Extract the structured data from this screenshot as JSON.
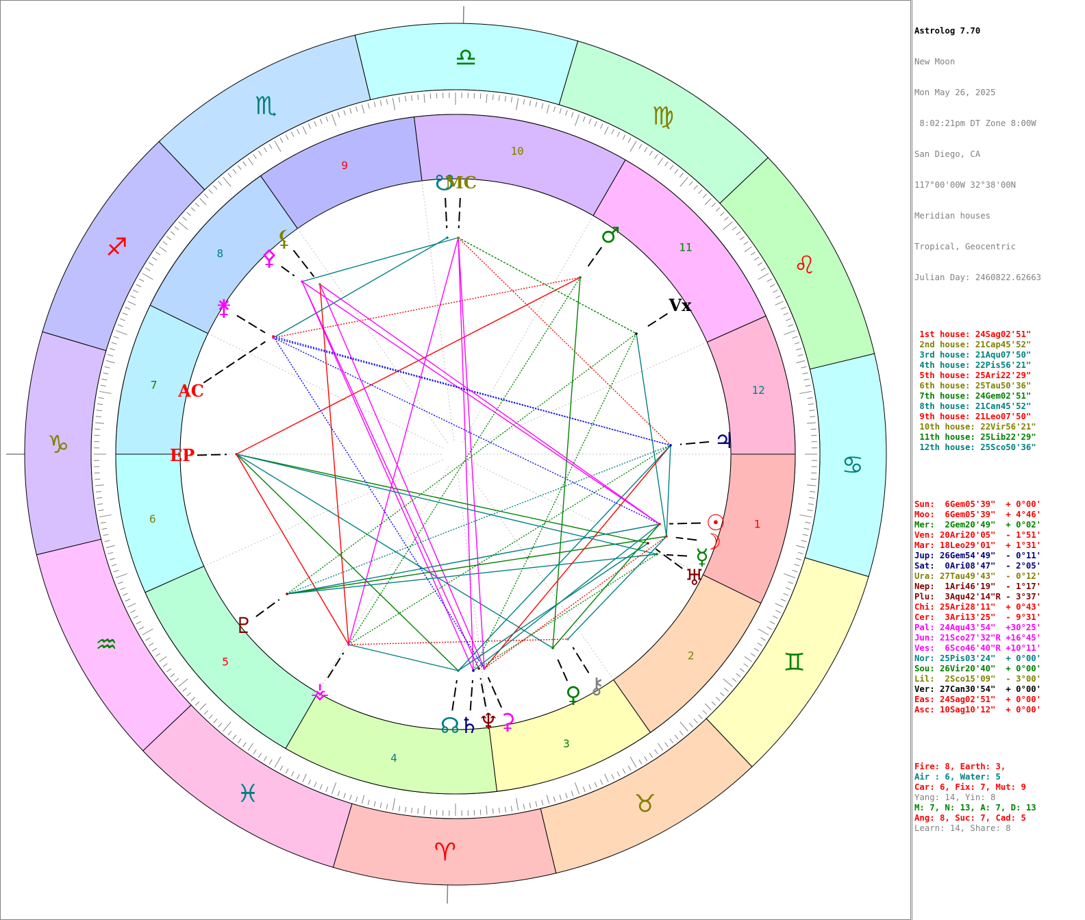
{
  "app": {
    "title": "Astrolog 7.70",
    "chart_name": "New Moon",
    "date": "Mon May 26, 2025",
    "time": " 8:02:21pm DT Zone 8:00W",
    "place": "San Diego, CA",
    "coords": "117°00'00W 32°38'00N",
    "house_system": "Meridian houses",
    "zodiac": "Tropical, Geocentric",
    "julian": "Julian Day: 2460822.62663"
  },
  "colors": {
    "fire": "#ff0000",
    "earth": "#808000",
    "air": "#008080",
    "water": "#008000",
    "sign_bands": [
      "#ffb8b8",
      "#ffd8b8",
      "#ffffb8",
      "#b8ffb8",
      "#b8f0ff",
      "#b8d8ff",
      "#b8b8ff",
      "#d8b8ff",
      "#ffb8ff",
      "#ffb8d8",
      "#b8ffff",
      "#b8ffb8"
    ]
  },
  "houses": [
    {
      "text": "1st house: 24Sag02'51\"",
      "color": "#ff0000"
    },
    {
      "text": "2nd house: 21Cap45'52\"",
      "color": "#808000"
    },
    {
      "text": "3rd house: 21Aqu07'50\"",
      "color": "#008080"
    },
    {
      "text": "4th house: 22Pis56'21\"",
      "color": "#008080"
    },
    {
      "text": "5th house: 25Ari22'29\"",
      "color": "#ff0000"
    },
    {
      "text": "6th house: 25Tau50'36\"",
      "color": "#808000"
    },
    {
      "text": "7th house: 24Gem02'51\"",
      "color": "#008000"
    },
    {
      "text": "8th house: 21Can45'52\"",
      "color": "#008080"
    },
    {
      "text": "9th house: 21Leo07'50\"",
      "color": "#ff0000"
    },
    {
      "text": "10th house: 22Vir56'21\"",
      "color": "#808000"
    },
    {
      "text": "11th house: 25Lib22'29\"",
      "color": "#008000"
    },
    {
      "text": "12th house: 25Sco50'36\"",
      "color": "#008080"
    }
  ],
  "planets": [
    {
      "text": "Sun:  6Gem05'39\"  + 0°00'",
      "color": "#ff0000"
    },
    {
      "text": "Moo:  6Gem05'39\"  + 4°46'",
      "color": "#ff0000"
    },
    {
      "text": "Mer:  2Gem20'49\"  + 0°02'",
      "color": "#008000"
    },
    {
      "text": "Ven: 20Ari20'05\"  - 1°51'",
      "color": "#ff0000"
    },
    {
      "text": "Mar: 18Leo29'01\"  + 1°31'",
      "color": "#ff0000"
    },
    {
      "text": "Jup: 26Gem54'49\"  - 0°11'",
      "color": "#000080"
    },
    {
      "text": "Sat:  0Ari08'47\"  - 2°05'",
      "color": "#000080"
    },
    {
      "text": "Ura: 27Tau49'43\"  - 0°12'",
      "color": "#808000"
    },
    {
      "text": "Nep:  1Ari46'19\"  - 1°17'",
      "color": "#800000"
    },
    {
      "text": "Plu:  3Aqu42'14\"R - 3°37'",
      "color": "#800000"
    },
    {
      "text": "Chi: 25Ari28'11\"  + 0°43'",
      "color": "#ff0000"
    },
    {
      "text": "Cer:  3Ari13'25\"  - 9°31'",
      "color": "#ff0000"
    },
    {
      "text": "Pal: 24Aqu43'54\"  +30°25'",
      "color": "#ff00ff"
    },
    {
      "text": "Jun: 21Sco27'32\"R +16°45'",
      "color": "#ff00ff"
    },
    {
      "text": "Ves:  6Sco46'40\"R +10°11'",
      "color": "#ff00ff"
    },
    {
      "text": "Nor: 25Pis03'24\"  + 0°00'",
      "color": "#008080"
    },
    {
      "text": "Sou: 26Vir20'40\"  + 0°00'",
      "color": "#008000"
    },
    {
      "text": "Lil:  2Sco15'09\"  - 3°00'",
      "color": "#808000"
    },
    {
      "text": "Ver: 27Can30'54\"  + 0°00'",
      "color": "#000000"
    },
    {
      "text": "Eas: 24Sag02'51\"  + 0°00'",
      "color": "#ff0000"
    },
    {
      "text": "Asc: 10Sag10'12\"  + 0°00'",
      "color": "#ff0000"
    }
  ],
  "stats": [
    {
      "text": "Fire: 8, Earth: 3,",
      "color": "#ff0000"
    },
    {
      "text": "Air : 6, Water: 5",
      "color": "#008080"
    },
    {
      "text": "Car: 6, Fix: 7, Mut: 9",
      "color": "#ff0000"
    },
    {
      "text": "Yang: 14, Yin: 8",
      "color": "#808080"
    },
    {
      "text": "M: 7, N: 13, A: 7, D: 13",
      "color": "#008000"
    },
    {
      "text": "Ang: 8, Suc: 7, Cad: 5",
      "color": "#ff0000"
    },
    {
      "text": "Learn: 14, Share: 8",
      "color": "#808080"
    }
  ],
  "wheel": {
    "signs": [
      {
        "glyph": "♈",
        "color": "#ff0000",
        "name": "aries"
      },
      {
        "glyph": "♉",
        "color": "#808000",
        "name": "taurus"
      },
      {
        "glyph": "♊",
        "color": "#008000",
        "name": "gemini"
      },
      {
        "glyph": "♋",
        "color": "#008080",
        "name": "cancer"
      },
      {
        "glyph": "♌",
        "color": "#ff0000",
        "name": "leo"
      },
      {
        "glyph": "♍",
        "color": "#808000",
        "name": "virgo"
      },
      {
        "glyph": "♎",
        "color": "#008000",
        "name": "libra"
      },
      {
        "glyph": "♏",
        "color": "#008080",
        "name": "scorpio"
      },
      {
        "glyph": "♐",
        "color": "#ff0000",
        "name": "sagittarius"
      },
      {
        "glyph": "♑",
        "color": "#808000",
        "name": "capricorn"
      },
      {
        "glyph": "♒",
        "color": "#008000",
        "name": "aquarius"
      },
      {
        "glyph": "♓",
        "color": "#008080",
        "name": "pisces"
      }
    ],
    "house_numbers": [
      {
        "label": "1",
        "color": "#ff0000",
        "fill": "#ffb8b8"
      },
      {
        "label": "2",
        "color": "#808000",
        "fill": "#ffd8b8"
      },
      {
        "label": "3",
        "color": "#008000",
        "fill": "#ffffb8"
      },
      {
        "label": "4",
        "color": "#008080",
        "fill": "#d8ffb8"
      },
      {
        "label": "5",
        "color": "#ff0000",
        "fill": "#b8ffd8"
      },
      {
        "label": "6",
        "color": "#808000",
        "fill": "#b8ffff"
      },
      {
        "label": "7",
        "color": "#008000",
        "fill": "#b8f0ff"
      },
      {
        "label": "8",
        "color": "#008080",
        "fill": "#b8d8ff"
      },
      {
        "label": "9",
        "color": "#ff0000",
        "fill": "#b8b8ff"
      },
      {
        "label": "10",
        "color": "#808000",
        "fill": "#d8b8ff"
      },
      {
        "label": "11",
        "color": "#008000",
        "fill": "#ffb8ff"
      },
      {
        "label": "12",
        "color": "#008080",
        "fill": "#ffb8d8"
      }
    ],
    "points": [
      {
        "glyph": "☉",
        "name": "sun",
        "color": "#ff0000"
      },
      {
        "glyph": "☽",
        "name": "moon",
        "color": "#ff0000"
      },
      {
        "glyph": "☿",
        "name": "mercury",
        "color": "#008000"
      },
      {
        "glyph": "♀",
        "name": "venus",
        "color": "#008000"
      },
      {
        "glyph": "♂",
        "name": "mars",
        "color": "#008000"
      },
      {
        "glyph": "♃",
        "name": "jupiter",
        "color": "#000080"
      },
      {
        "glyph": "♄",
        "name": "saturn",
        "color": "#000080"
      },
      {
        "glyph": "♅",
        "name": "uranus",
        "color": "#800000"
      },
      {
        "glyph": "♆",
        "name": "neptune",
        "color": "#800000"
      },
      {
        "glyph": "♇",
        "name": "pluto",
        "color": "#800000"
      },
      {
        "glyph": "⚷",
        "name": "chiron",
        "color": "#808080"
      },
      {
        "glyph": "⚳",
        "name": "ceres",
        "color": "#ff00ff"
      },
      {
        "glyph": "⚴",
        "name": "pallas",
        "color": "#ff00ff"
      },
      {
        "glyph": "⚵",
        "name": "juno",
        "color": "#ff00ff"
      },
      {
        "glyph": "⚶",
        "name": "vesta",
        "color": "#ff00ff"
      },
      {
        "glyph": "☊",
        "name": "north-node",
        "color": "#008080"
      },
      {
        "glyph": "☋",
        "name": "south-node",
        "color": "#008080"
      },
      {
        "glyph": "⚸",
        "name": "lilith",
        "color": "#808000"
      },
      {
        "glyph": "Vx",
        "name": "vertex",
        "color": "#000000"
      },
      {
        "glyph": "EP",
        "name": "east-point",
        "color": "#ff0000"
      },
      {
        "glyph": "AC",
        "name": "ascendant",
        "color": "#ff0000"
      },
      {
        "glyph": "MC",
        "name": "midheaven",
        "color": "#808000"
      }
    ]
  }
}
